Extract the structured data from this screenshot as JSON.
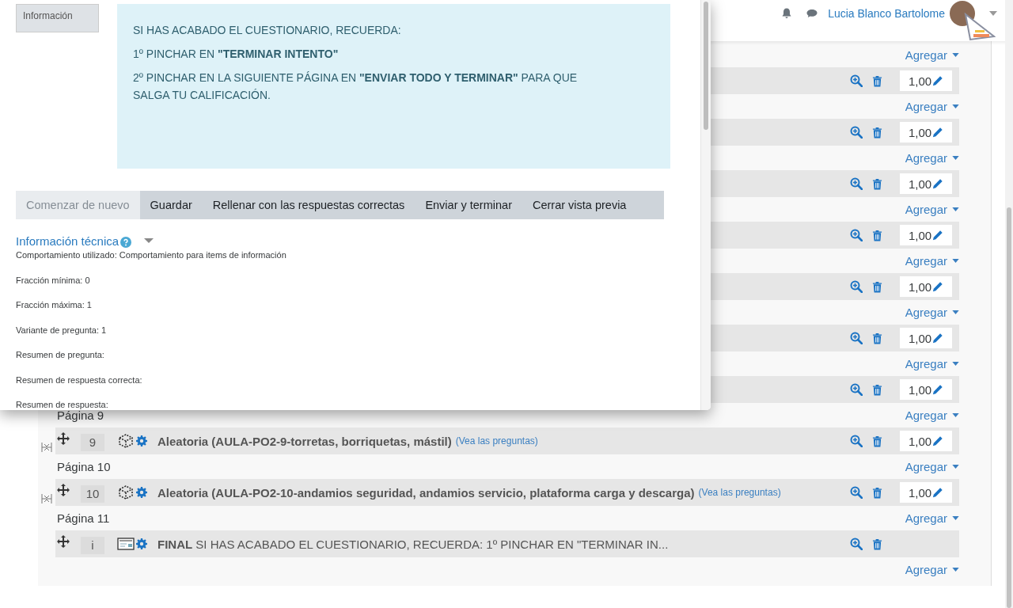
{
  "header": {
    "user_name": "Lucia Blanco Bartolome"
  },
  "quiz": {
    "sections": [
      {
        "add_link": "Agregar",
        "slot": {
          "mark": "1,00"
        }
      },
      {
        "add_link": "Agregar",
        "slot": {
          "mark": "1,00"
        }
      },
      {
        "add_link": "Agregar",
        "slot": {
          "mark": "1,00"
        }
      },
      {
        "add_link": "Agregar",
        "slot": {
          "mark": "1,00"
        }
      },
      {
        "add_link": "Agregar",
        "slot": {
          "mark": "1,00"
        }
      },
      {
        "add_link": "Agregar",
        "slot": {
          "mark": "1,00"
        }
      },
      {
        "add_link": "Agregar",
        "slot": {
          "mark": "1,00"
        }
      },
      {
        "label": "Página 9",
        "add_link": "Agregar",
        "slot": {
          "number": "9",
          "kind": "random",
          "title": "Aleatoria (AULA-PO2-9-torretas, borriquetas, mástil)",
          "link": "(Vea las preguntas)",
          "mark": "1,00"
        }
      },
      {
        "label": "Página 10",
        "add_link": "Agregar",
        "slot": {
          "number": "10",
          "kind": "random",
          "title": "Aleatoria (AULA-PO2-10-andamios seguridad, andamios servicio, plataforma carga y descarga)",
          "link": "(Vea las preguntas)",
          "mark": "1,00"
        }
      },
      {
        "label": "Página 11",
        "add_link": "Agregar",
        "slot": {
          "number": "i",
          "kind": "description",
          "title": "**FINAL** SI HAS ACABADO EL CUESTIONARIO, RECUERDA:  1º PINCHAR EN \"TERMINAR IN..."
        }
      }
    ],
    "trailing_add": "Agregar"
  },
  "preview": {
    "info_label": "Información",
    "message": [
      "SI HAS ACABADO EL CUESTIONARIO, RECUERDA:",
      "1º PINCHAR EN **\"TERMINAR INTENTO\"**",
      "2º PINCHAR EN LA SIGUIENTE PÁGINA EN **\"ENVIAR TODO Y TERMINAR\"** PARA QUE SALGA TU CALIFICACIÓN."
    ],
    "buttons": [
      {
        "label": "Comenzar de nuevo",
        "disabled": true
      },
      {
        "label": "Guardar",
        "disabled": false
      },
      {
        "label": "Rellenar con las respuestas correctas",
        "disabled": false
      },
      {
        "label": "Enviar y terminar",
        "disabled": false
      },
      {
        "label": "Cerrar vista previa",
        "disabled": false
      }
    ],
    "tech_info": {
      "title": "Información técnica",
      "expanded": true,
      "lines": [
        "Comportamiento utilizado: Comportamiento para items de información",
        "Fracción mínima: 0",
        "Fracción máxima: 1",
        "Variante de pregunta: 1",
        "Resumen de pregunta:",
        "Resumen de respuesta correcta:",
        "Resumen de respuesta:"
      ]
    }
  }
}
